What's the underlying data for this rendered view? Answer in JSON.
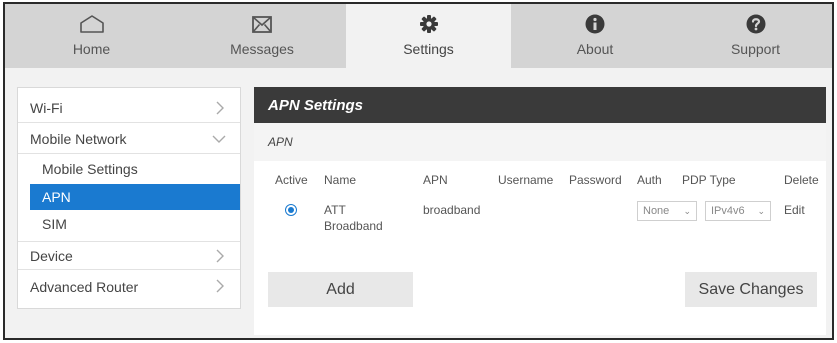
{
  "nav": {
    "tabs": [
      {
        "label": "Home",
        "icon": "home-icon"
      },
      {
        "label": "Messages",
        "icon": "envelope-icon"
      },
      {
        "label": "Settings",
        "icon": "gear-icon"
      },
      {
        "label": "About",
        "icon": "info-icon"
      },
      {
        "label": "Support",
        "icon": "question-icon"
      }
    ],
    "active": "Settings"
  },
  "sidebar": {
    "items": [
      {
        "label": "Wi-Fi"
      },
      {
        "label": "Mobile Network",
        "expanded": true,
        "children": [
          {
            "label": "Mobile Settings"
          },
          {
            "label": "APN",
            "selected": true
          },
          {
            "label": "SIM"
          }
        ]
      },
      {
        "label": "Device"
      },
      {
        "label": "Advanced Router"
      }
    ]
  },
  "main": {
    "title": "APN Settings",
    "section": "APN",
    "table": {
      "headers": [
        "Active",
        "Name",
        "APN",
        "Username",
        "Password",
        "Auth",
        "PDP Type",
        "Delete"
      ],
      "rows": [
        {
          "active": true,
          "name_line1": "ATT",
          "name_line2": "Broadband",
          "apn": "broadband",
          "username": "",
          "password": "",
          "auth": "None",
          "pdp_type": "IPv4v6",
          "delete": "Edit"
        }
      ]
    },
    "add_label": "Add",
    "save_label": "Save Changes"
  },
  "colors": {
    "accent": "#1a7ad0",
    "header_bg": "#3a3a3a",
    "nav_bg": "#d4d4d4",
    "page_bg": "#f2f2f2"
  }
}
